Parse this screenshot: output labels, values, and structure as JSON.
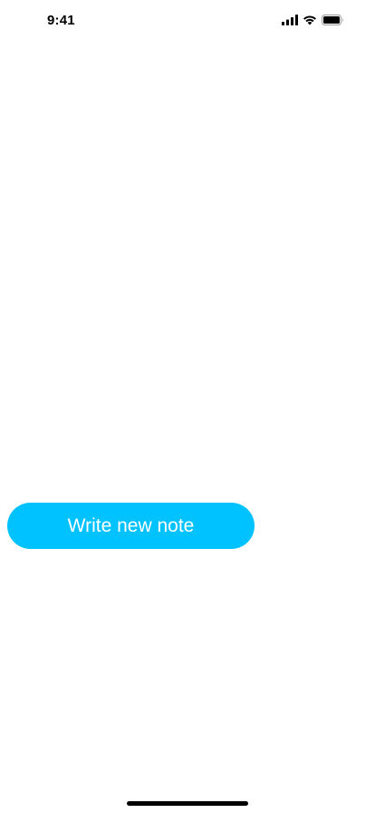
{
  "status_bar": {
    "time": "9:41",
    "icons": [
      "cellular-signal-icon",
      "wifi-icon",
      "battery-icon"
    ]
  },
  "main": {
    "write_note_label": "Write new note"
  },
  "colors": {
    "accent": "#00C2FF",
    "background": "#FFFFFF",
    "text_on_accent": "#FFFFFF"
  }
}
